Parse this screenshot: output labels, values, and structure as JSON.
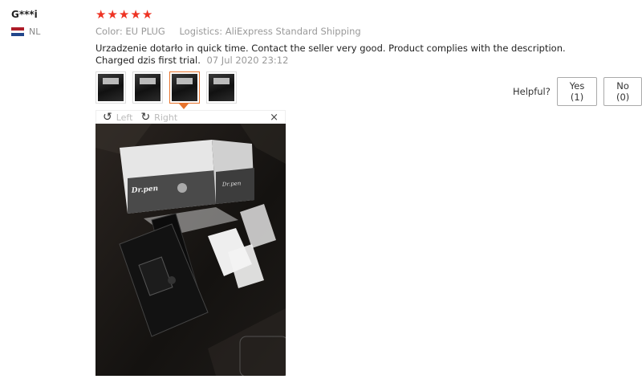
{
  "reviewer": {
    "name": "G***i",
    "country_code": "NL",
    "flag_colors": [
      "#ae1c28",
      "#ffffff",
      "#21468b"
    ]
  },
  "rating": {
    "stars": 5,
    "star_color": "#ee3323"
  },
  "meta": {
    "color": "Color: EU PLUG",
    "logistics": "Logistics: AliExpress Standard Shipping"
  },
  "review": {
    "text": "Urzadzenie dotarło in quick time. Contact the seller very good. Product complies with the description. Charged dzis first trial.",
    "date": "07 Jul 2020 23:12"
  },
  "thumbnails": [
    {
      "icon": "review-photo"
    },
    {
      "icon": "review-photo"
    },
    {
      "icon": "review-photo",
      "selected": true
    },
    {
      "icon": "review-photo"
    }
  ],
  "helpful": {
    "label": "Helpful?",
    "yes": "Yes (1)",
    "no": "No (0)"
  },
  "viewer": {
    "left": "Left",
    "right": "Right",
    "close": "×"
  },
  "photo": {
    "box_brand": "Dr.pen",
    "box_brand_side": "Dr.pen"
  },
  "accent_color": "#e8742d"
}
